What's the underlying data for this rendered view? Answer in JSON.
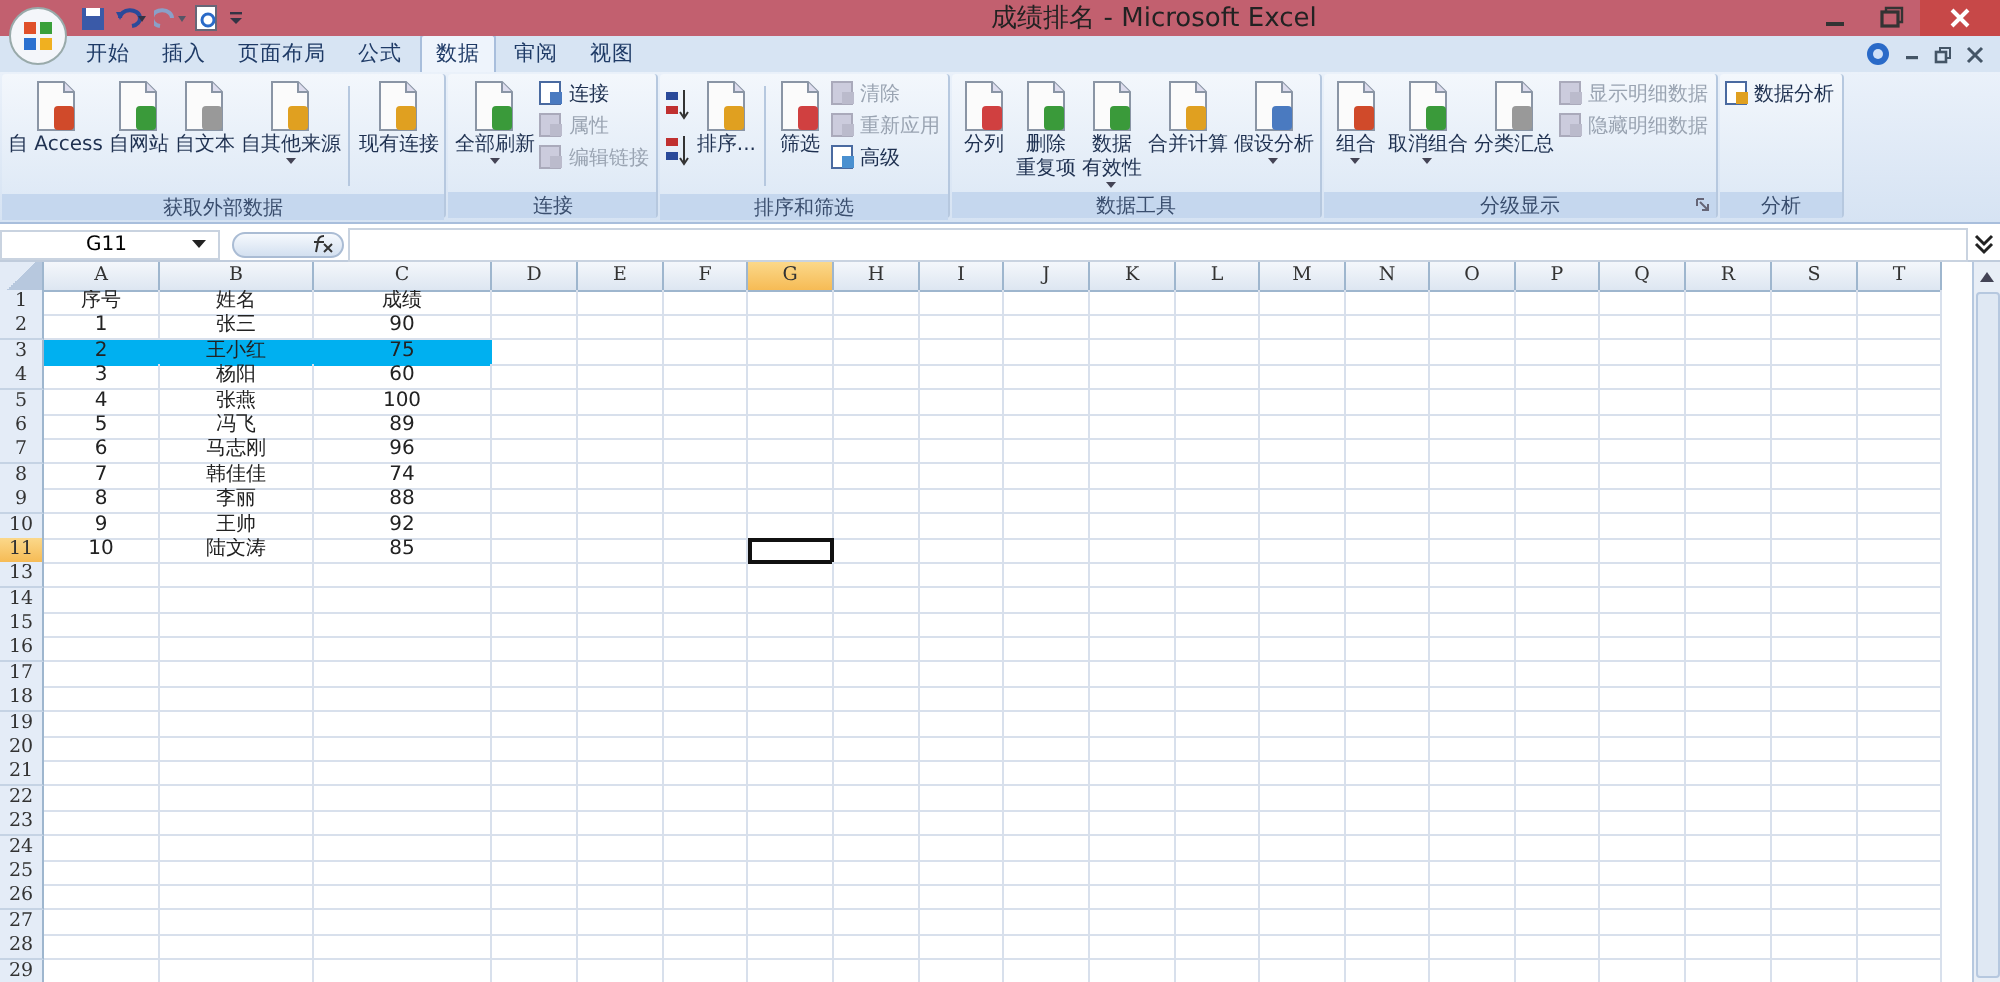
{
  "window": {
    "title": "成绩排名 - Microsoft Excel"
  },
  "tabs": [
    {
      "label": "开始",
      "selected": false
    },
    {
      "label": "插入",
      "selected": false
    },
    {
      "label": "页面布局",
      "selected": false
    },
    {
      "label": "公式",
      "selected": false
    },
    {
      "label": "数据",
      "selected": true
    },
    {
      "label": "审阅",
      "selected": false
    },
    {
      "label": "视图",
      "selected": false
    }
  ],
  "ribbon": {
    "groups": [
      {
        "label": "获取外部数据",
        "launcher": false,
        "columns": [
          [
            {
              "kind": "large",
              "label": "自 Access",
              "dropdown": false
            }
          ],
          [
            {
              "kind": "large",
              "label": "自网站",
              "dropdown": false
            }
          ],
          [
            {
              "kind": "large",
              "label": "自文本",
              "dropdown": false
            }
          ],
          [
            {
              "kind": "large",
              "label": "自其他来源",
              "dropdown": true
            }
          ],
          [
            {
              "kind": "separator"
            }
          ],
          [
            {
              "kind": "large",
              "label": "现有连接",
              "dropdown": false
            }
          ]
        ]
      },
      {
        "label": "连接",
        "launcher": false,
        "columns": [
          [
            {
              "kind": "large",
              "label": "全部刷新",
              "dropdown": true
            }
          ],
          [
            {
              "kind": "small",
              "label": "连接",
              "disabled": false
            },
            {
              "kind": "small",
              "label": "属性",
              "disabled": true
            },
            {
              "kind": "small",
              "label": "编辑链接",
              "disabled": true
            }
          ]
        ]
      },
      {
        "label": "排序和筛选",
        "launcher": false,
        "columns": [
          [
            {
              "kind": "icon",
              "disabled": false
            },
            {
              "kind": "icon",
              "disabled": false
            }
          ],
          [
            {
              "kind": "large",
              "label": "排序...",
              "dropdown": false
            }
          ],
          [
            {
              "kind": "separator"
            }
          ],
          [
            {
              "kind": "large",
              "label": "筛选",
              "dropdown": false
            }
          ],
          [
            {
              "kind": "small",
              "label": "清除",
              "disabled": true
            },
            {
              "kind": "small",
              "label": "重新应用",
              "disabled": true
            },
            {
              "kind": "small",
              "label": "高级",
              "disabled": false
            }
          ]
        ]
      },
      {
        "label": "数据工具",
        "launcher": false,
        "columns": [
          [
            {
              "kind": "large",
              "label": "分列",
              "dropdown": false
            }
          ],
          [
            {
              "kind": "large",
              "lines": [
                "删除",
                "重复项"
              ],
              "dropdown": false
            }
          ],
          [
            {
              "kind": "large",
              "lines": [
                "数据",
                "有效性"
              ],
              "dropdown": true
            }
          ],
          [
            {
              "kind": "large",
              "label": "合并计算",
              "dropdown": false
            }
          ],
          [
            {
              "kind": "large",
              "label": "假设分析",
              "dropdown": true
            }
          ]
        ]
      },
      {
        "label": "分级显示",
        "launcher": true,
        "columns": [
          [
            {
              "kind": "large",
              "label": "组合",
              "dropdown": true
            }
          ],
          [
            {
              "kind": "large",
              "label": "取消组合",
              "dropdown": true
            }
          ],
          [
            {
              "kind": "large",
              "label": "分类汇总",
              "dropdown": false
            }
          ],
          [
            {
              "kind": "small",
              "label": "显示明细数据",
              "disabled": true
            },
            {
              "kind": "small",
              "label": "隐藏明细数据",
              "disabled": true
            }
          ]
        ]
      },
      {
        "label": "分析",
        "launcher": false,
        "columns": [
          [
            {
              "kind": "small",
              "label": "数据分析",
              "disabled": false
            }
          ]
        ]
      }
    ]
  },
  "name_box": {
    "value": "G11"
  },
  "columns": [
    {
      "label": "A",
      "selected": false
    },
    {
      "label": "B",
      "selected": false
    },
    {
      "label": "C",
      "selected": false
    },
    {
      "label": "D",
      "selected": false
    },
    {
      "label": "E",
      "selected": false
    },
    {
      "label": "F",
      "selected": false
    },
    {
      "label": "G",
      "selected": true
    },
    {
      "label": "H",
      "selected": false
    },
    {
      "label": "I",
      "selected": false
    },
    {
      "label": "J",
      "selected": false
    },
    {
      "label": "K",
      "selected": false
    },
    {
      "label": "L",
      "selected": false
    },
    {
      "label": "M",
      "selected": false
    },
    {
      "label": "N",
      "selected": false
    },
    {
      "label": "O",
      "selected": false
    },
    {
      "label": "P",
      "selected": false
    },
    {
      "label": "Q",
      "selected": false
    },
    {
      "label": "R",
      "selected": false
    },
    {
      "label": "S",
      "selected": false
    },
    {
      "label": "T",
      "selected": false
    }
  ],
  "rows": [
    {
      "header": "1",
      "selected": false,
      "highlighted": false,
      "cells": [
        "序号",
        "姓名",
        "成绩"
      ]
    },
    {
      "header": "2",
      "selected": false,
      "highlighted": false,
      "cells": [
        "1",
        "张三",
        "90"
      ]
    },
    {
      "header": "3",
      "selected": false,
      "highlighted": true,
      "cells": [
        "2",
        "王小红",
        "75"
      ]
    },
    {
      "header": "4",
      "selected": false,
      "highlighted": false,
      "cells": [
        "3",
        "杨阳",
        "60"
      ]
    },
    {
      "header": "5",
      "selected": false,
      "highlighted": false,
      "cells": [
        "4",
        "张燕",
        "100"
      ]
    },
    {
      "header": "6",
      "selected": false,
      "highlighted": false,
      "cells": [
        "5",
        "冯飞",
        "89"
      ]
    },
    {
      "header": "7",
      "selected": false,
      "highlighted": false,
      "cells": [
        "6",
        "马志刚",
        "96"
      ]
    },
    {
      "header": "8",
      "selected": false,
      "highlighted": false,
      "cells": [
        "7",
        "韩佳佳",
        "74"
      ]
    },
    {
      "header": "9",
      "selected": false,
      "highlighted": false,
      "cells": [
        "8",
        "李丽",
        "88"
      ]
    },
    {
      "header": "10",
      "selected": false,
      "highlighted": false,
      "cells": [
        "9",
        "王帅",
        "92"
      ]
    },
    {
      "header": "11",
      "selected": true,
      "highlighted": false,
      "cells": [
        "10",
        "陆文涛",
        "85"
      ]
    },
    {
      "header": "13",
      "selected": false,
      "highlighted": false
    },
    {
      "header": "14",
      "selected": false,
      "highlighted": false
    },
    {
      "header": "15",
      "selected": false,
      "highlighted": false
    },
    {
      "header": "16",
      "selected": false,
      "highlighted": false
    },
    {
      "header": "17",
      "selected": false,
      "highlighted": false
    },
    {
      "header": "18",
      "selected": false,
      "highlighted": false
    },
    {
      "header": "19",
      "selected": false,
      "highlighted": false
    },
    {
      "header": "20",
      "selected": false,
      "highlighted": false
    },
    {
      "header": "21",
      "selected": false,
      "highlighted": false
    },
    {
      "header": "22",
      "selected": false,
      "highlighted": false
    },
    {
      "header": "23",
      "selected": false,
      "highlighted": false
    },
    {
      "header": "24",
      "selected": false,
      "highlighted": false
    },
    {
      "header": "25",
      "selected": false,
      "highlighted": false
    },
    {
      "header": "26",
      "selected": false,
      "highlighted": false
    },
    {
      "header": "27",
      "selected": false,
      "highlighted": false
    },
    {
      "header": "28",
      "selected": false,
      "highlighted": false
    },
    {
      "header": "29",
      "selected": false,
      "highlighted": false
    }
  ]
}
